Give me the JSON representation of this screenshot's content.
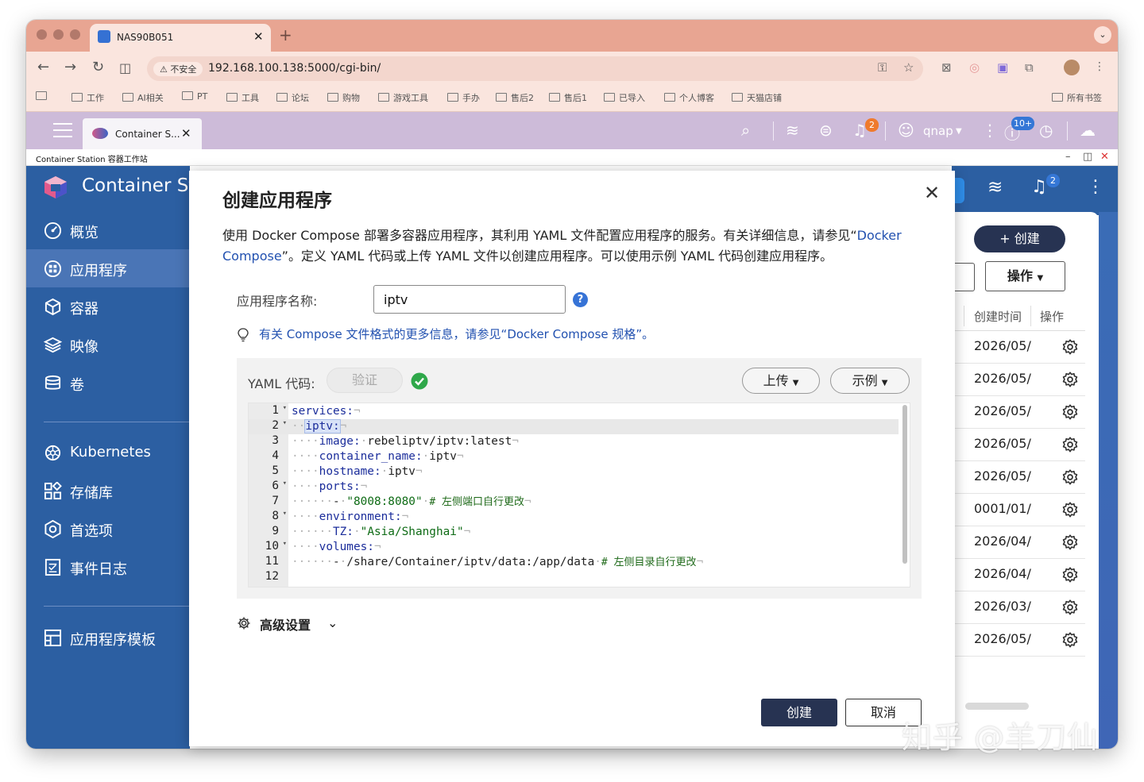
{
  "browser": {
    "tab_title": "NAS90B051",
    "new_tab": "+",
    "tab_menu": "⌄",
    "insecure_label": "不安全",
    "url": "192.168.100.138:5000/cgi-bin/"
  },
  "bookmarks": {
    "items": [
      "工作",
      "AI相关",
      "PT",
      "工具",
      "论坛",
      "购物",
      "游戏工具",
      "手办",
      "售后2",
      "售后1",
      "已导入",
      "个人博客",
      "天猫店铺"
    ],
    "all_label": "所有书签"
  },
  "qts": {
    "tab_label": "Container S...",
    "user": "qnap",
    "notif_badge": "2",
    "info_badge": "10+"
  },
  "app_window": {
    "title": "Container Station 容器工作站"
  },
  "sidebar": {
    "brand": "Container Station",
    "items": [
      {
        "label": "概览",
        "icon": "dashboard-icon"
      },
      {
        "label": "应用程序",
        "icon": "apps-icon"
      },
      {
        "label": "容器",
        "icon": "container-icon"
      },
      {
        "label": "映像",
        "icon": "image-layers-icon"
      },
      {
        "label": "卷",
        "icon": "volume-db-icon"
      },
      {
        "label": "Kubernetes",
        "icon": "kubernetes-icon"
      },
      {
        "label": "存储库",
        "icon": "registry-icon"
      },
      {
        "label": "首选项",
        "icon": "preferences-icon"
      },
      {
        "label": "事件日志",
        "icon": "event-log-icon"
      },
      {
        "label": "应用程序模板",
        "icon": "template-icon"
      }
    ]
  },
  "main": {
    "create_button": "+ 创建",
    "actions_button": "操作",
    "col_created": "创建时间",
    "col_actions": "操作",
    "notif_badge": "2",
    "rows": [
      "2026/05/",
      "2026/05/",
      "2026/05/",
      "2026/05/",
      "2026/05/",
      "0001/01/",
      "2026/04/",
      "2026/04/",
      "2026/03/",
      "2026/05/"
    ]
  },
  "modal": {
    "title": "创建应用程序",
    "desc_before": "使用 Docker Compose 部署多容器应用程序，其利用 YAML 文件配置应用程序的服务。有关详细信息，请参见“",
    "desc_link": "Docker Compose",
    "desc_after": "”。定义 YAML 代码或上传 YAML 文件以创建应用程序。可以使用示例 YAML 代码创建应用程序。",
    "name_label": "应用程序名称:",
    "name_value": "iptv",
    "help": "?",
    "hint": "有关 Compose 文件格式的更多信息，请参见“Docker Compose 规格”。",
    "yaml_label": "YAML 代码:",
    "verify": "验证",
    "upload": "上传",
    "example": "示例",
    "advanced": "高级设置",
    "create": "创建",
    "cancel": "取消"
  },
  "editor": {
    "lines": [
      {
        "n": "1",
        "fold": true
      },
      {
        "n": "2",
        "fold": true
      },
      {
        "n": "3",
        "fold": false
      },
      {
        "n": "4",
        "fold": false
      },
      {
        "n": "5",
        "fold": false
      },
      {
        "n": "6",
        "fold": true
      },
      {
        "n": "7",
        "fold": false
      },
      {
        "n": "8",
        "fold": true
      },
      {
        "n": "9",
        "fold": false
      },
      {
        "n": "10",
        "fold": true
      },
      {
        "n": "11",
        "fold": false
      },
      {
        "n": "12",
        "fold": false
      }
    ],
    "code": {
      "l1": "services:",
      "l2": "iptv:",
      "l3k": "image:",
      "l3v": "rebeliptv/iptv:latest",
      "l4k": "container_name:",
      "l4v": "iptv",
      "l5k": "hostname:",
      "l5v": "iptv",
      "l6": "ports:",
      "l7v": "\"8008:8080\"",
      "l7c": "# 左侧端口自行更改",
      "l8": "environment:",
      "l9k": "TZ:",
      "l9v": "\"Asia/Shanghai\"",
      "l10": "volumes:",
      "l11v": "/share/Container/iptv/data:/app/data",
      "l11c": "# 左侧目录自行更改"
    }
  },
  "watermark": "知乎 @羊刀仙",
  "colors": {
    "sidebar": "#2c5fa2",
    "sidebar_active": "#4a75b6",
    "primary_dark": "#273352",
    "link": "#2251b0",
    "browser_tab": "#e8a592",
    "qts_bar": "#cdbbd9"
  }
}
